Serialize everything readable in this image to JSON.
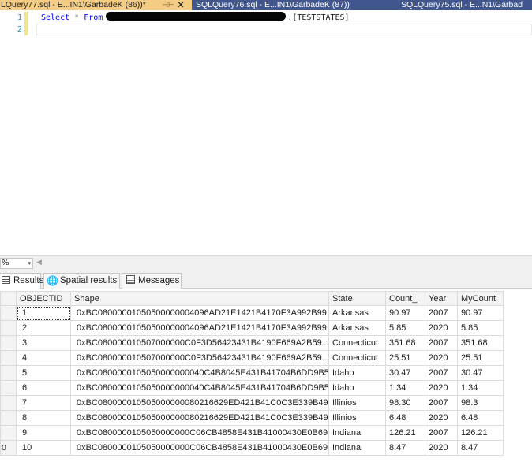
{
  "tabs": {
    "active": {
      "title": "LQuery77.sql - E...IN1\\GarbadeK (86))*",
      "pin": "⊣⊢",
      "close": "✕"
    },
    "second": {
      "title": "SQLQuery76.sql - E...IN1\\GarbadeK (87))"
    },
    "third": {
      "title": "SQLQuery75.sql - E...N1\\Garbad"
    }
  },
  "editor": {
    "line_numbers": [
      "1",
      "2"
    ],
    "line1": {
      "kw_select": "Select",
      "star": "*",
      "kw_from": "From",
      "object": ".[TESTSTATES]"
    }
  },
  "zoom": {
    "value": "%",
    "arrow": "▾",
    "scroll_left": "◀"
  },
  "result_tabs": {
    "results": "Results",
    "spatial": "Spatial results",
    "messages": "Messages"
  },
  "grid": {
    "columns": [
      "OBJECTID",
      "Shape",
      "State",
      "Count_",
      "Year",
      "MyCount"
    ],
    "rows": [
      {
        "rownum": "",
        "objectid": "1",
        "shape": "0xBC08000001050500000004096AD21E1421B4170F3A992B99...",
        "state": "Arkansas",
        "count": "90.97",
        "year": "2007",
        "mycount": "90.97"
      },
      {
        "rownum": "",
        "objectid": "2",
        "shape": "0xBC08000001050500000004096AD21E1421B4170F3A992B99...",
        "state": "Arkansas",
        "count": "5.85",
        "year": "2020",
        "mycount": "5.85"
      },
      {
        "rownum": "",
        "objectid": "3",
        "shape": "0xBC080000010507000000C0F3D56423431B4190F669A2B59...",
        "state": "Connecticut",
        "count": "351.68",
        "year": "2007",
        "mycount": "351.68"
      },
      {
        "rownum": "",
        "objectid": "4",
        "shape": "0xBC080000010507000000C0F3D56423431B4190F669A2B59...",
        "state": "Connecticut",
        "count": "25.51",
        "year": "2020",
        "mycount": "25.51"
      },
      {
        "rownum": "",
        "objectid": "5",
        "shape": "0xBC0800000105050000000040C4B8045E431B41704B6DD9B5...",
        "state": "Idaho",
        "count": "30.47",
        "year": "2007",
        "mycount": "30.47"
      },
      {
        "rownum": "",
        "objectid": "6",
        "shape": "0xBC0800000105050000000040C4B8045E431B41704B6DD9B5...",
        "state": "Idaho",
        "count": "1.34",
        "year": "2020",
        "mycount": "1.34"
      },
      {
        "rownum": "",
        "objectid": "7",
        "shape": "0xBC080000010505000000080216629ED421B41C0C3E339B49...",
        "state": "Illinios",
        "count": "98.30",
        "year": "2007",
        "mycount": "98.3"
      },
      {
        "rownum": "",
        "objectid": "8",
        "shape": "0xBC080000010505000000080216629ED421B41C0C3E339B49...",
        "state": "Illinios",
        "count": "6.48",
        "year": "2020",
        "mycount": "6.48"
      },
      {
        "rownum": "",
        "objectid": "9",
        "shape": "0xBC0800000105050000000C06CB4858E431B41000430E0B69...",
        "state": "Indiana",
        "count": "126.21",
        "year": "2007",
        "mycount": "126.21"
      },
      {
        "rownum": "0",
        "objectid": "10",
        "shape": "0xBC0800000105050000000C06CB4858E431B41000430E0B69...",
        "state": "Indiana",
        "count": "8.47",
        "year": "2020",
        "mycount": "8.47"
      }
    ]
  }
}
